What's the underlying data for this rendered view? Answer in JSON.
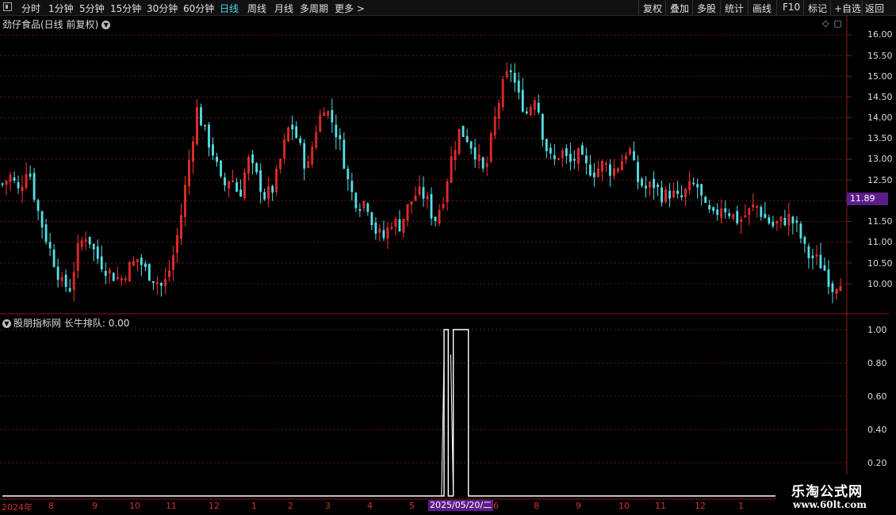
{
  "toolbar": {
    "periods": [
      "分时",
      "1分钟",
      "5分钟",
      "15分钟",
      "30分钟",
      "60分钟",
      "日线",
      "周线",
      "月线",
      "多周期",
      "更多 >"
    ],
    "active_period": "日线",
    "actions": [
      "复权",
      "叠加",
      "多股",
      "统计",
      "画线",
      "F10",
      "标记",
      "+自选",
      "返回"
    ]
  },
  "stock": {
    "title": "劲仔食品(日线 前复权)"
  },
  "price_axis": {
    "labels": [
      "16.00",
      "15.50",
      "15.00",
      "14.50",
      "14.00",
      "13.50",
      "13.00",
      "12.50",
      "12.00",
      "11.50",
      "11.00",
      "10.50",
      "10.00"
    ],
    "current_price": "11.89"
  },
  "indicator": {
    "title": "股朋指标网",
    "name": "长牛排队:",
    "value": "0.00",
    "axis_labels": [
      "1.00",
      "0.80",
      "0.60",
      "0.40",
      "0.20"
    ]
  },
  "x_axis": {
    "labels": [
      "2024年",
      "8",
      "9",
      "10",
      "11",
      "12",
      "1",
      "2",
      "3",
      "4",
      "5",
      "6",
      "8",
      "9",
      "10",
      "11",
      "12",
      "1"
    ],
    "cursor_date": "2025/05/20/二"
  },
  "watermark": {
    "name": "乐淘公式网",
    "url": "www.60lt.com"
  },
  "colors": {
    "up": "#ff3232",
    "down": "#54e0e8",
    "grid": "#6a1818",
    "axis": "#8a1a1a",
    "price_tag": "#5b1d8a"
  },
  "chart_data": {
    "type": "candlestick",
    "title": "劲仔食品(日线 前复权)",
    "ylim": [
      9.7,
      16.2
    ],
    "approx_close_path": [
      12.4,
      12.6,
      12.2,
      12.9,
      11.9,
      11.2,
      10.6,
      10.0,
      9.9,
      10.9,
      11.2,
      10.7,
      10.4,
      10.2,
      10.1,
      10.4,
      10.6,
      10.3,
      10.1,
      9.9,
      10.5,
      11.5,
      12.9,
      14.2,
      13.6,
      13.1,
      12.3,
      12.6,
      12.1,
      13.0,
      12.6,
      12.1,
      12.3,
      13.1,
      13.9,
      13.4,
      12.7,
      13.7,
      14.3,
      13.9,
      13.3,
      12.3,
      11.9,
      12.0,
      11.3,
      11.1,
      11.5,
      11.4,
      11.9,
      12.2,
      12.1,
      11.5,
      12.0,
      13.0,
      13.7,
      13.5,
      13.1,
      12.6,
      13.8,
      14.7,
      15.2,
      14.5,
      14.1,
      14.6,
      13.4,
      12.9,
      13.2,
      12.9,
      13.1,
      12.8,
      12.7,
      12.9,
      12.7,
      12.9,
      13.3,
      12.5,
      12.3,
      12.4,
      12.1,
      12.2,
      12.0,
      12.3,
      12.4,
      11.8,
      11.6,
      11.9,
      11.7,
      11.5,
      11.7,
      11.9,
      11.6,
      11.4,
      11.5,
      11.6,
      11.3,
      10.7,
      10.6,
      10.4,
      9.9,
      10.1
    ],
    "indicator_series": {
      "name": "长牛排队",
      "ylim": [
        0,
        1.05
      ],
      "nonzero": [
        {
          "date_index_fraction": 0.5,
          "value": 1.0
        },
        {
          "date_index_fraction": 0.505,
          "value": 1.0
        },
        {
          "date_index_fraction": 0.515,
          "value": 1.0
        }
      ]
    }
  }
}
